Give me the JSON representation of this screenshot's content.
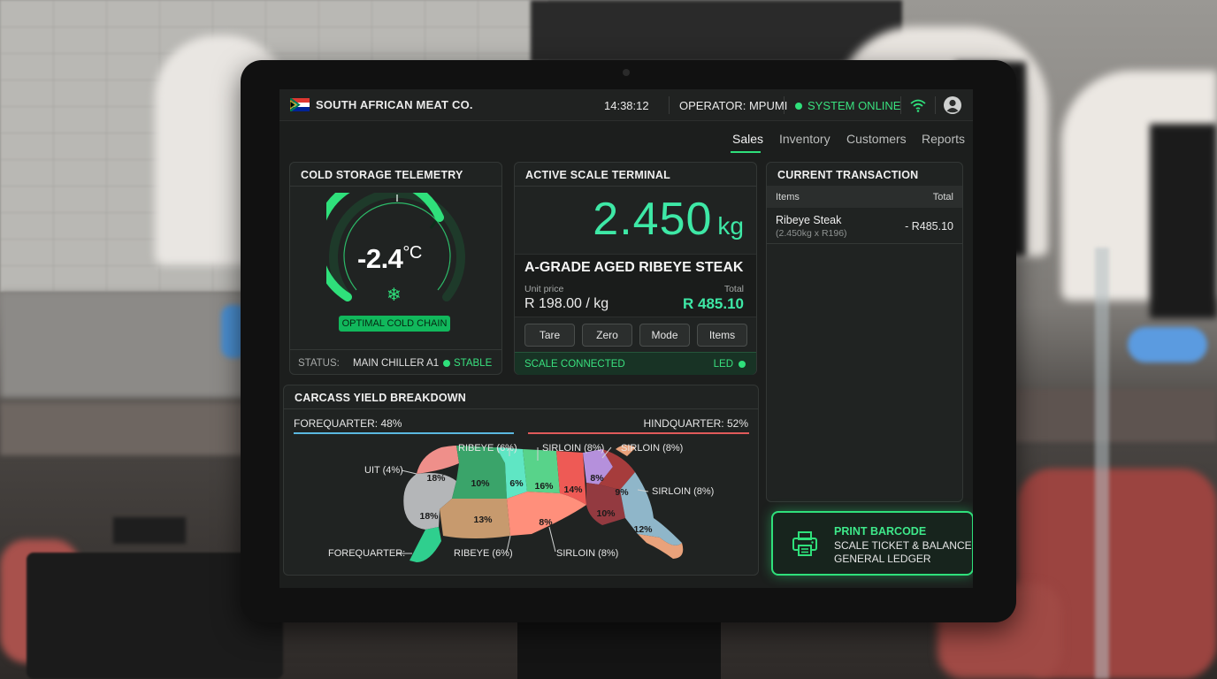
{
  "header": {
    "brand": "SOUTH AFRICAN MEAT CO.",
    "time": "14:38:12",
    "operator": "OPERATOR: MPUMI",
    "status": "SYSTEM ONLINE",
    "icons": [
      "flag-icon",
      "wifi-icon",
      "user-icon"
    ]
  },
  "nav": {
    "tabs": [
      "Sales",
      "Inventory",
      "Customers",
      "Reports"
    ],
    "active": "Sales"
  },
  "cold_storage": {
    "title": "COLD STORAGE TELEMETRY",
    "temperature": "-2.4",
    "unit": "°C",
    "badge": "OPTIMAL COLD CHAIN",
    "status_label": "STATUS:",
    "location": "MAIN CHILLER A1",
    "state": "STABLE"
  },
  "scale": {
    "title": "ACTIVE SCALE TERMINAL",
    "weight": "2.450",
    "weight_unit": "kg",
    "product": "A-GRADE AGED RIBEYE STEAK",
    "unit_price_label": "Unit price",
    "unit_price": "R 198.00 / kg",
    "total_label": "Total",
    "total": "R 485.10",
    "buttons": [
      "Tare",
      "Zero",
      "Mode",
      "Items"
    ],
    "connection": "SCALE CONNECTED",
    "led": "LED"
  },
  "transaction": {
    "title": "CURRENT TRANSACTION",
    "col_items": "Items",
    "col_total": "Total",
    "rows": [
      {
        "name": "Ribeye Steak",
        "detail": "(2.450kg x R196)",
        "price": "- R485.10"
      }
    ]
  },
  "print_button": {
    "line1": "PRINT BARCODE",
    "line2": "SCALE TICKET & BALANCE",
    "line3": "GENERAL LEDGER"
  },
  "carcass": {
    "title": "CARCASS YIELD BREAKDOWN",
    "forequarter": "FOREQUARTER: 48%",
    "hindquarter": "HINDQUARTER: 52%",
    "segments": [
      "18%",
      "18%",
      "10%",
      "13%",
      "6%",
      "16%",
      "14%",
      "8%",
      "9%",
      "10%",
      "12%",
      "8%"
    ],
    "callouts": [
      "UIT (4%)",
      "RIBEYE (6%)",
      "SIRLOIN (8%)",
      "SIRLOIN (8%)",
      "SIRLOIN (8%)",
      "FOREQUARTER:",
      "RIBEYE (6%)",
      "SIRLOIN (8%)"
    ]
  },
  "colors": {
    "accent": "#2fe07b",
    "weight": "#3ee8a6",
    "forequarter_line": "#5ab8e0",
    "hindquarter_line": "#e05a5a"
  }
}
